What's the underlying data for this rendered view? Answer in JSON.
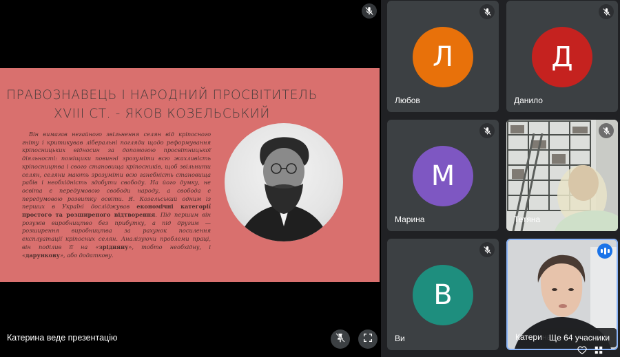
{
  "presentation": {
    "presenter_label": "Катерина веде презентацію",
    "slide": {
      "title_line1": "ПРАВОЗНАВЕЦЬ І НАРОДНИЙ ПРОСВІТИТЕЛЬ",
      "title_line2": "XVIII СТ. - ЯКОВ КОЗЕЛЬСЬКИЙ",
      "body_part1": "Він вимагав негайного звільнення селян від кріпосного гніту і критикував ліберальні погляди щодо реформування кріпосницьких відносин за допомогою просвітницької діяльності: поміщики повинні зрозуміти всю жахливість кріпосництва і свого становища кріпосників, щоб звільнити селян, селяни мають зрозуміти всю ганебність становища рабів і необхідність здобути свободу. На його думку, не освіта є передумовою свободи народу, а свобода є передумовою розвитку освіти. Я. Козельський одним із перших в Україні досліджував ",
      "body_bold1": "економічні категорії простого та розширеного відтворення",
      "body_part2": ". Під першим він розумів виробництво без прибутку, а під другим — розширення виробництва за рахунок посилення експлуатації кріпосних селян. Аналізуючи проблеми праці, він поділив її на «",
      "body_bold2": "зрідняну",
      "body_part3": "», тобто необхідну, і «",
      "body_bold3": "дарункову",
      "body_part4": "», або додаткову."
    }
  },
  "participants": [
    {
      "name": "Любов",
      "initial": "Л",
      "color": "#e8710a",
      "muted": true
    },
    {
      "name": "Данило",
      "initial": "Д",
      "color": "#c5221f",
      "muted": true
    },
    {
      "name": "Марина",
      "initial": "М",
      "color": "#7e57c2",
      "muted": true
    },
    {
      "name": "Тетяна",
      "muted": true,
      "video": true
    },
    {
      "name": "Ви",
      "initial": "В",
      "color": "#1e8e7e",
      "muted": true
    },
    {
      "name": "Катерина",
      "video": true,
      "speaking": true
    }
  ],
  "overflow": {
    "label": "Ще 64 учасники"
  },
  "colors": {
    "background": "#202124",
    "tile": "#3c4043",
    "slide": "#d9706e",
    "speaking_border": "#8ab4f8"
  }
}
